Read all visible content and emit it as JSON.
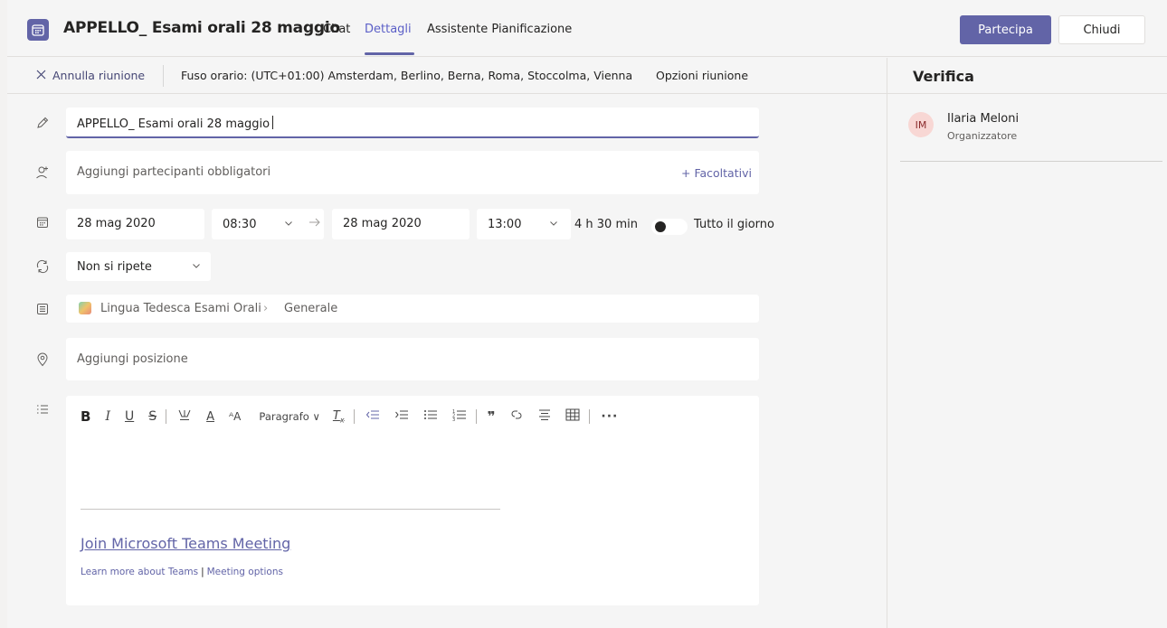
{
  "header": {
    "title": "APPELLO_ Esami orali 28 maggio",
    "tabs": [
      {
        "label": "Chat"
      },
      {
        "label": "Dettagli"
      },
      {
        "label": "Assistente Pianificazione"
      }
    ],
    "join_label": "Partecipa",
    "close_label": "Chiudi"
  },
  "subbar": {
    "cancel_label": "Annulla riunione",
    "timezone": "Fuso orario: (UTC+01:00) Amsterdam, Berlino, Berna, Roma, Stoccolma, Vienna",
    "options_label": "Opzioni riunione"
  },
  "form": {
    "title_value": "APPELLO_ Esami orali 28 maggio",
    "attendees_placeholder": "Aggiungi partecipanti obbligatori",
    "optional_label": "+ Facoltativi",
    "start_date": "28 mag 2020",
    "start_time": "08:30",
    "end_date": "28 mag 2020",
    "end_time": "13:00",
    "duration": "4 h 30 min",
    "all_day_label": "Tutto il giorno",
    "all_day": false,
    "repeat": "Non si ripete",
    "channel_team": "Lingua Tedesca Esami Orali",
    "channel_name": "Generale",
    "location_placeholder": "Aggiungi posizione"
  },
  "editor": {
    "paragraph_label": "Paragrafo",
    "join_link": "Join Microsoft Teams Meeting",
    "learn_more": "Learn more about Teams",
    "separator": "|",
    "meeting_options": "Meeting options"
  },
  "sidebar": {
    "title": "Verifica",
    "attendees": [
      {
        "initials": "IM",
        "name": "Ilaria Meloni",
        "role": "Organizzatore"
      }
    ]
  },
  "colors": {
    "accent": "#6264a7",
    "avatar_bg": "#f8d7d4"
  }
}
